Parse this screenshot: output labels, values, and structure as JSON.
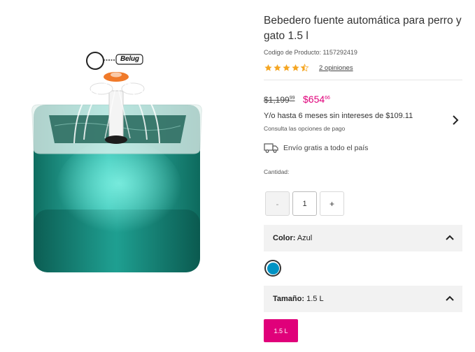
{
  "product": {
    "image": {
      "brand": "Belug",
      "description_icon": "pet-water-fountain-image"
    },
    "title": "Bebedero fuente automática para perro y gato 1.5 l",
    "sku_text": "Codigo de Producto: 1157292419",
    "rating": {
      "value": 4.5,
      "max": 5,
      "reviews_label": "2 opiniones"
    },
    "price": {
      "old_main": "$1,199",
      "old_cents": "99",
      "new_main": "$654",
      "new_cents": "66"
    },
    "installments": {
      "text": "Y/o hasta 6 meses sin intereses de $109.11",
      "sub": "Consulta las opciones de pago"
    },
    "shipping": {
      "icon": "truck-icon",
      "text": "Envío gratis a todo el país"
    },
    "quantity": {
      "label": "Cantidad:",
      "value": "1",
      "minus": "-",
      "plus": "+"
    },
    "color": {
      "label": "Color:",
      "value": "Azul",
      "swatch_color": "#0093c4"
    },
    "size": {
      "label": "Tamaño:",
      "value": "1.5 L",
      "chip": "1.5 L"
    }
  },
  "colors": {
    "accent": "#e0007a",
    "star": "#f5a623"
  }
}
